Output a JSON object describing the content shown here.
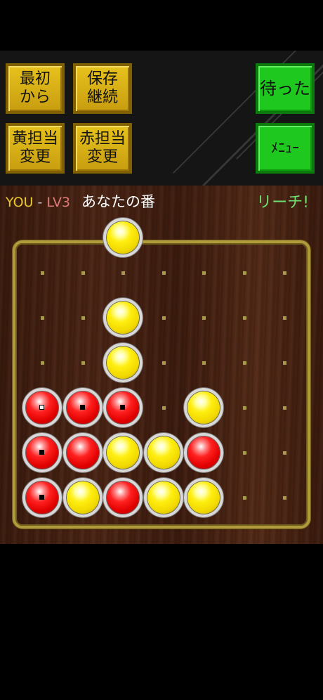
{
  "toolbar": {
    "restart": [
      "最初",
      "から"
    ],
    "save_continue": [
      "保存",
      "継続"
    ],
    "yellow_change": [
      "黄担当",
      "変更"
    ],
    "red_change": [
      "赤担当",
      "変更"
    ],
    "undo": "待った",
    "menu": "ﾒﾆｭｰ"
  },
  "status": {
    "player": "YOU",
    "separator": "-",
    "level": "LV3",
    "turn": "あなたの番",
    "alert": "リーチ!"
  },
  "board": {
    "columns": 7,
    "rows": 6,
    "cells": [
      [
        "",
        "",
        "",
        "",
        "",
        "",
        ""
      ],
      [
        "",
        "",
        "yellow",
        "",
        "",
        "",
        ""
      ],
      [
        "",
        "",
        "yellow",
        "",
        "",
        "",
        ""
      ],
      [
        "red",
        "red",
        "red",
        "",
        "yellow",
        "",
        ""
      ],
      [
        "red",
        "red",
        "yellow",
        "yellow",
        "red",
        "",
        ""
      ],
      [
        "red",
        "yellow",
        "red",
        "yellow",
        "yellow",
        "",
        ""
      ]
    ],
    "marked": [
      [
        3,
        0
      ],
      [
        3,
        1
      ],
      [
        3,
        2
      ],
      [
        4,
        0
      ],
      [
        5,
        0
      ]
    ],
    "last_move": [
      3,
      0
    ],
    "pending_piece": {
      "color": "yellow",
      "column": 2
    }
  },
  "colors": {
    "button_gold": "#d4ac14",
    "button_green": "#1ec81e",
    "player_text": "#e8c82c",
    "level_text": "#e07a7a",
    "reach_text": "#6ee06e",
    "frame": "#b09a3c"
  }
}
